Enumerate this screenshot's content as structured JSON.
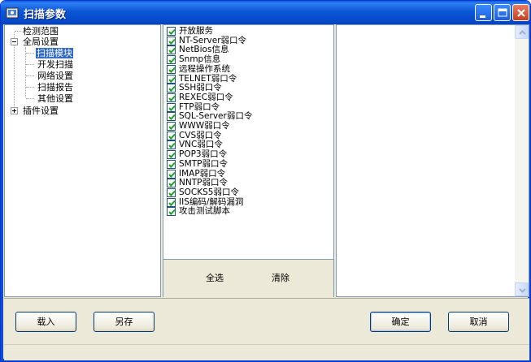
{
  "window": {
    "title": "扫描参数"
  },
  "tree": {
    "items": [
      {
        "label": "检测范围"
      },
      {
        "label": "全局设置"
      },
      {
        "label": "扫描模块"
      },
      {
        "label": "开发扫描"
      },
      {
        "label": "网络设置"
      },
      {
        "label": "扫描报告"
      },
      {
        "label": "其他设置"
      },
      {
        "label": "插件设置"
      }
    ]
  },
  "modules": [
    {
      "label": "开放服务",
      "checked": true
    },
    {
      "label": "NT-Server弱口令",
      "checked": true
    },
    {
      "label": "NetBios信息",
      "checked": true
    },
    {
      "label": "Snmp信息",
      "checked": true
    },
    {
      "label": "远程操作系统",
      "checked": true
    },
    {
      "label": "TELNET弱口令",
      "checked": true
    },
    {
      "label": "SSH弱口令",
      "checked": true
    },
    {
      "label": "REXEC弱口令",
      "checked": true
    },
    {
      "label": "FTP弱口令",
      "checked": true
    },
    {
      "label": "SQL-Server弱口令",
      "checked": true
    },
    {
      "label": "WWW弱口令",
      "checked": true
    },
    {
      "label": "CVS弱口令",
      "checked": true
    },
    {
      "label": "VNC弱口令",
      "checked": true
    },
    {
      "label": "POP3弱口令",
      "checked": true
    },
    {
      "label": "SMTP弱口令",
      "checked": true
    },
    {
      "label": "IMAP弱口令",
      "checked": true
    },
    {
      "label": "NNTP弱口令",
      "checked": true
    },
    {
      "label": "SOCKS5弱口令",
      "checked": true
    },
    {
      "label": "IIS编码/解码漏洞",
      "checked": true
    },
    {
      "label": "攻击测试脚本",
      "checked": true
    }
  ],
  "actions": {
    "select_all": "全选",
    "clear": "清除"
  },
  "buttons": {
    "load": "载入",
    "save_as": "另存",
    "ok": "确定",
    "cancel": "取消"
  },
  "colors": {
    "titlebar": "#0a57d6",
    "selection": "#316ac5",
    "face": "#ece9d8"
  }
}
